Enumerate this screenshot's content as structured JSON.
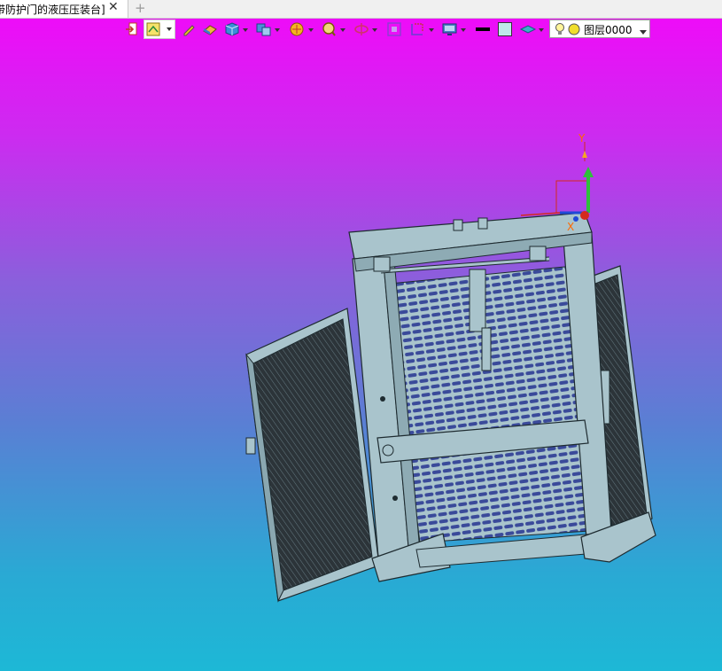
{
  "tab": {
    "title": "带防护门的液压压装台]",
    "close_glyph": "✕",
    "add_glyph": "+"
  },
  "toolbar": {
    "layer_value": "图层0000",
    "icons": [
      "exit-icon",
      "display-filter-icon",
      "pencil-icon",
      "eraser-icon",
      "cube-view-icon",
      "multi-view-icon",
      "render-mode-icon",
      "zoom-icon",
      "rotate-icon",
      "fit-icon",
      "frame-icon",
      "display-settings-icon",
      "line-color-icon",
      "fill-color-icon",
      "layer-icon",
      "bulb-icon"
    ]
  },
  "colors": {
    "background_top": "#ee0cf8",
    "background_bottom": "#1db8d6",
    "model_fill": "#a9c4cc",
    "model_stroke": "#1e2b30",
    "panel_dark": "#2b3338",
    "axis_x": "#d32a1e",
    "axis_y": "#2ec13b",
    "axis_z": "#1f4ad8",
    "triad_label": "#ff6a00"
  },
  "triad": {
    "x_label": "X",
    "y_label": "Y"
  }
}
